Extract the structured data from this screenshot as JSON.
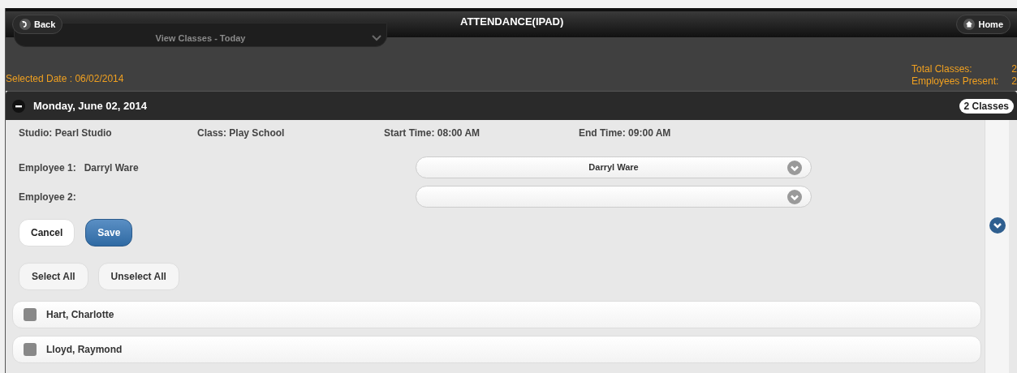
{
  "header": {
    "back": "Back",
    "title": "ATTENDANCE(IPAD)",
    "home": "Home",
    "view_select": "View Classes - Today"
  },
  "selected_date": "Selected Date : 06/02/2014",
  "totals": [
    {
      "label": "Total Classes:",
      "value": "2"
    },
    {
      "label": "Employees Present:",
      "value": "2"
    }
  ],
  "day": {
    "title": "Monday, June 02, 2014",
    "count": "2 Classes",
    "expanded": true
  },
  "class_info": [
    "Studio: Pearl Studio",
    "Class: Play School",
    "Start Time: 08:00 AM",
    "End Time: 09:00 AM"
  ],
  "employees": [
    {
      "label": "Employee 1:",
      "name": "Darryl Ware",
      "select_value": "Darryl Ware"
    },
    {
      "label": "Employee 2:"
    }
  ],
  "actions": [
    {
      "label": "Cancel",
      "kind": "plain"
    },
    {
      "label": "Save",
      "kind": "primary"
    }
  ],
  "selection_buttons": [
    "Select All",
    "Unselect All"
  ],
  "people": [
    {
      "name": "Hart, Charlotte",
      "checked": false
    },
    {
      "name": "Lloyd, Raymond",
      "checked": false
    }
  ]
}
